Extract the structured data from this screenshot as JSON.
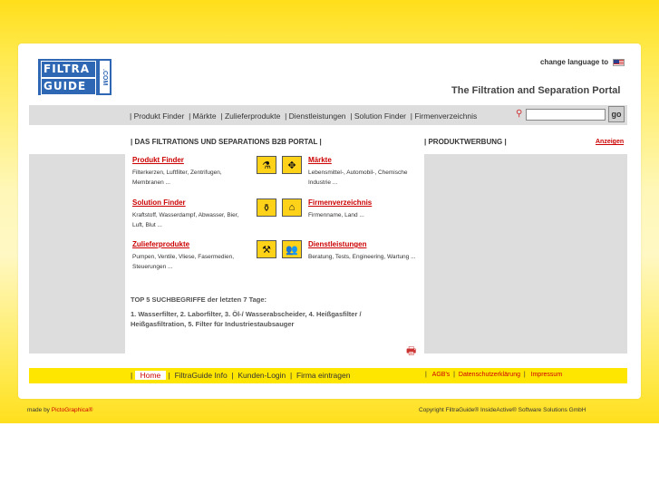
{
  "header": {
    "logo_top": "FILTRA",
    "logo_bottom": "GUIDE",
    "logo_dotcom": ".COM",
    "change_language": "change language to",
    "portal_title": "The Filtration and Separation Portal"
  },
  "nav": {
    "items": [
      "Produkt Finder",
      "Märkte",
      "Zulieferprodukte",
      "Dienstleistungen",
      "Solution Finder",
      "Firmenverzeichnis"
    ],
    "search_placeholder": "",
    "go_label": "go"
  },
  "main": {
    "section_title": "| DAS FILTRATIONS UND SEPARATIONS B2B PORTAL |",
    "werbung_title": "| PRODUKTWERBUNG |",
    "anzeigen": "Anzeigen",
    "categories": [
      {
        "title": "Produkt Finder",
        "desc": "Filterkerzen, Luftfilter, Zentrifugen, Membranen ...",
        "icon": "filter-cartridge-icon"
      },
      {
        "title": "Märkte",
        "desc": "Lebensmittel-, Automobil-, Chemische Industrie ...",
        "icon": "markets-arrows-icon"
      },
      {
        "title": "Solution Finder",
        "desc": "Kraftstoff, Wasserdampf, Abwasser, Bier, Luft, Blut ...",
        "icon": "flask-icon"
      },
      {
        "title": "Firmenverzeichnis",
        "desc": "Firmenname, Land ...",
        "icon": "factory-icon"
      },
      {
        "title": "Zulieferprodukte",
        "desc": "Pumpen, Ventile, Vliese, Fasermedien, Steuerungen ...",
        "icon": "supplies-icon"
      },
      {
        "title": "Dienstleistungen",
        "desc": "Beratung, Tests, Engineering, Wartung ...",
        "icon": "people-icon"
      }
    ],
    "top5_title": "TOP 5 SUCHBEGRIFFE der letzten 7 Tage:",
    "top5_text": "1. Wasserfilter, 2. Laborfilter, 3. Öl-/ Wasserabscheider, 4. Heißgasfilter / Heißgasfiltration, 5. Filter für Industriestaubsauger"
  },
  "footer": {
    "home": "Home",
    "links": [
      "FiltraGuide Info",
      "Kunden-Login",
      "Firma eintragen"
    ],
    "right_links": [
      "AGB's",
      "Datenschutzerklärung",
      "Impressum"
    ],
    "made_by_prefix": "made by",
    "made_by_name": "PictoGraphica®",
    "copyright": "Copyright FiltraGuide® InsideActive® Software Solutions GmbH"
  },
  "colors": {
    "accent_red": "#cc0000",
    "brand_blue": "#2e67b4",
    "yellow": "#ffe600",
    "gray_bar": "#dddddd"
  }
}
